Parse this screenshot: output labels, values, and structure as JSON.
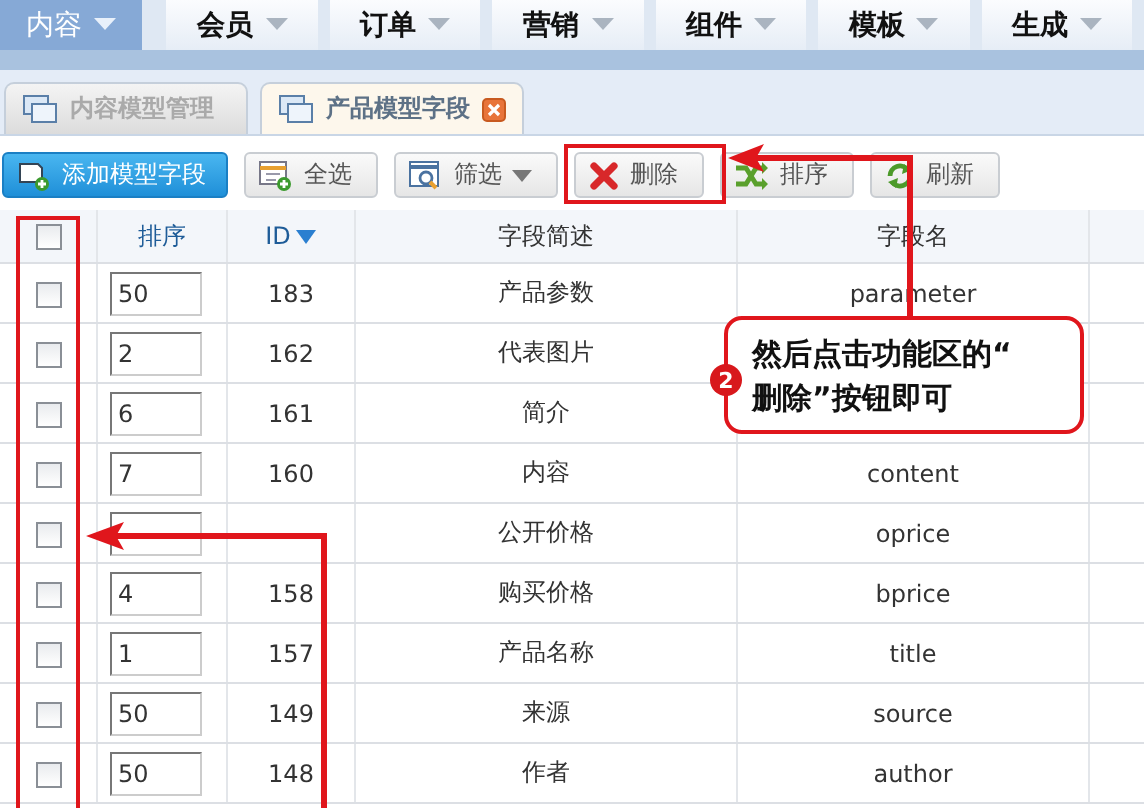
{
  "nav": [
    {
      "label": "内容",
      "selected": true
    },
    {
      "label": "会员",
      "selected": false
    },
    {
      "label": "订单",
      "selected": false
    },
    {
      "label": "营销",
      "selected": false
    },
    {
      "label": "组件",
      "selected": false
    },
    {
      "label": "模板",
      "selected": false
    },
    {
      "label": "生成",
      "selected": false
    }
  ],
  "tabs": [
    {
      "label": "内容模型管理",
      "selected": false
    },
    {
      "label": "产品模型字段",
      "selected": true
    }
  ],
  "toolbar": [
    {
      "label": "添加模型字段",
      "kind": "add"
    },
    {
      "label": "全选",
      "kind": "select-all"
    },
    {
      "label": "筛选",
      "kind": "filter"
    },
    {
      "label": "删除",
      "kind": "delete"
    },
    {
      "label": "排序",
      "kind": "sort"
    },
    {
      "label": "刷新",
      "kind": "refresh"
    }
  ],
  "table": {
    "header_checked": false,
    "columns": [
      {
        "label": "排序",
        "sortable": true,
        "sorted": false
      },
      {
        "label": "ID",
        "sortable": true,
        "sorted": true
      },
      {
        "label": "字段简述",
        "sortable": false,
        "sorted": false
      },
      {
        "label": "字段名",
        "sortable": false,
        "sorted": false
      }
    ],
    "rows": [
      {
        "checked": false,
        "order": "50",
        "id": "183",
        "description": "产品参数",
        "field_name": "parameter"
      },
      {
        "checked": false,
        "order": "2",
        "id": "162",
        "description": "代表图片"
      },
      {
        "checked": false,
        "order": "6",
        "id": "161",
        "description": "简介"
      },
      {
        "checked": false,
        "order": "7",
        "id": "160",
        "description": "内容",
        "field_name": "content"
      },
      {
        "checked": false,
        "description": "公开价格",
        "field_name": "oprice"
      },
      {
        "checked": false,
        "order": "4",
        "id": "158",
        "description": "购买价格",
        "field_name": "bprice"
      },
      {
        "checked": false,
        "order": "1",
        "id": "157",
        "description": "产品名称",
        "field_name": "title"
      },
      {
        "checked": false,
        "order": "50",
        "id": "149",
        "description": "来源",
        "field_name": "source"
      },
      {
        "checked": false,
        "order": "50",
        "id": "148",
        "description": "作者",
        "field_name": "author"
      }
    ]
  },
  "callout": {
    "number": "2",
    "text": "然后点击功能区的“\n删除”按钮即可"
  }
}
